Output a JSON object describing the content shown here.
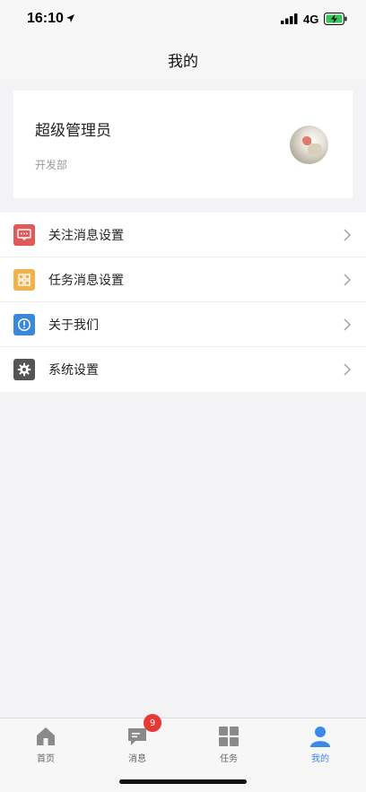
{
  "status_bar": {
    "time": "16:10",
    "network": "4G",
    "icons": [
      "location-icon",
      "signal-icon",
      "battery-charging-icon"
    ]
  },
  "nav": {
    "title": "我的"
  },
  "profile": {
    "name": "超级管理员",
    "department": "开发部"
  },
  "menu": {
    "items": [
      {
        "label": "关注消息设置",
        "icon": "message-icon",
        "color": "#e15a5a"
      },
      {
        "label": "任务消息设置",
        "icon": "grid-icon",
        "color": "#f0b24c"
      },
      {
        "label": "关于我们",
        "icon": "info-icon",
        "color": "#3b87d8"
      },
      {
        "label": "系统设置",
        "icon": "gear-icon",
        "color": "#555555"
      }
    ]
  },
  "tabs": {
    "items": [
      {
        "label": "首页",
        "icon": "home-icon"
      },
      {
        "label": "消息",
        "icon": "chat-icon",
        "badge": "9"
      },
      {
        "label": "任务",
        "icon": "grid-icon"
      },
      {
        "label": "我的",
        "icon": "person-icon",
        "active": true
      }
    ],
    "active_color": "#3c8ae8",
    "inactive_color": "#8a8a8a",
    "badge_color": "#e53935"
  }
}
